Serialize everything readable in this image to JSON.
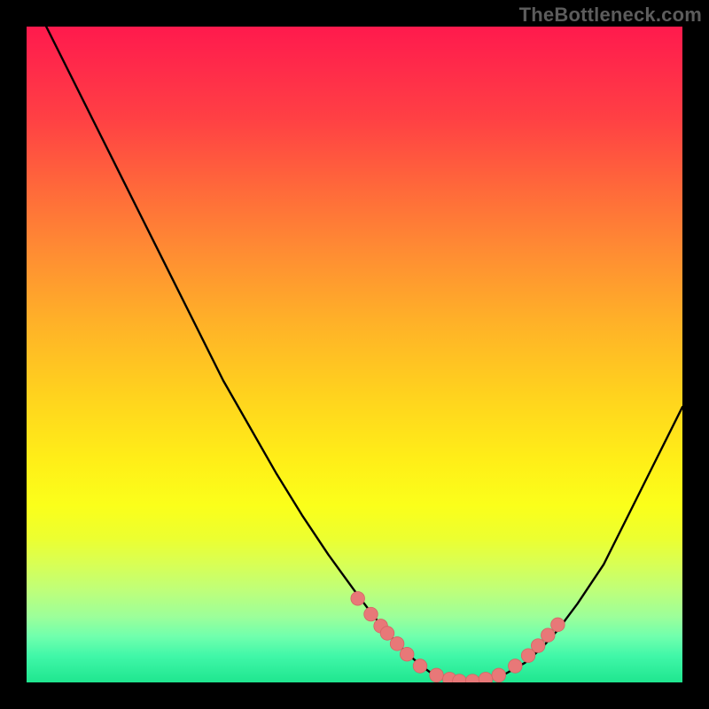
{
  "watermark": "TheBottleneck.com",
  "palette": {
    "curve_stroke": "#000000",
    "dot_fill": "#e87878",
    "dot_stroke": "#d46565"
  },
  "chart_data": {
    "type": "line",
    "title": "",
    "xlabel": "",
    "ylabel": "",
    "xlim": [
      0,
      100
    ],
    "ylim": [
      0,
      100
    ],
    "grid": false,
    "series": [
      {
        "name": "bottleneck-curve",
        "x": [
          0,
          2,
          6,
          10,
          14,
          18,
          22,
          26,
          30,
          34,
          38,
          42,
          46,
          50,
          53,
          56,
          58.5,
          60.5,
          62,
          64,
          67,
          70,
          73,
          76,
          78.5,
          81,
          84,
          88,
          92,
          96,
          100
        ],
        "y": [
          108,
          102,
          94,
          86,
          78,
          70,
          62,
          54,
          46,
          39,
          32,
          25.5,
          19.5,
          14,
          10,
          6.5,
          4,
          2.3,
          1.2,
          0.5,
          0.2,
          0.5,
          1.3,
          3,
          5.2,
          8,
          12,
          18,
          26,
          34,
          42
        ]
      }
    ],
    "dots": {
      "name": "sample-points",
      "x": [
        50.5,
        52.5,
        54,
        55,
        56.5,
        58,
        60,
        62.5,
        64.5,
        66,
        68,
        70,
        72,
        74.5,
        76.5,
        78,
        79.5,
        81
      ],
      "y": [
        12.8,
        10.4,
        8.6,
        7.5,
        5.9,
        4.3,
        2.5,
        1.1,
        0.5,
        0.2,
        0.2,
        0.5,
        1.1,
        2.5,
        4.1,
        5.6,
        7.2,
        8.8
      ]
    }
  }
}
